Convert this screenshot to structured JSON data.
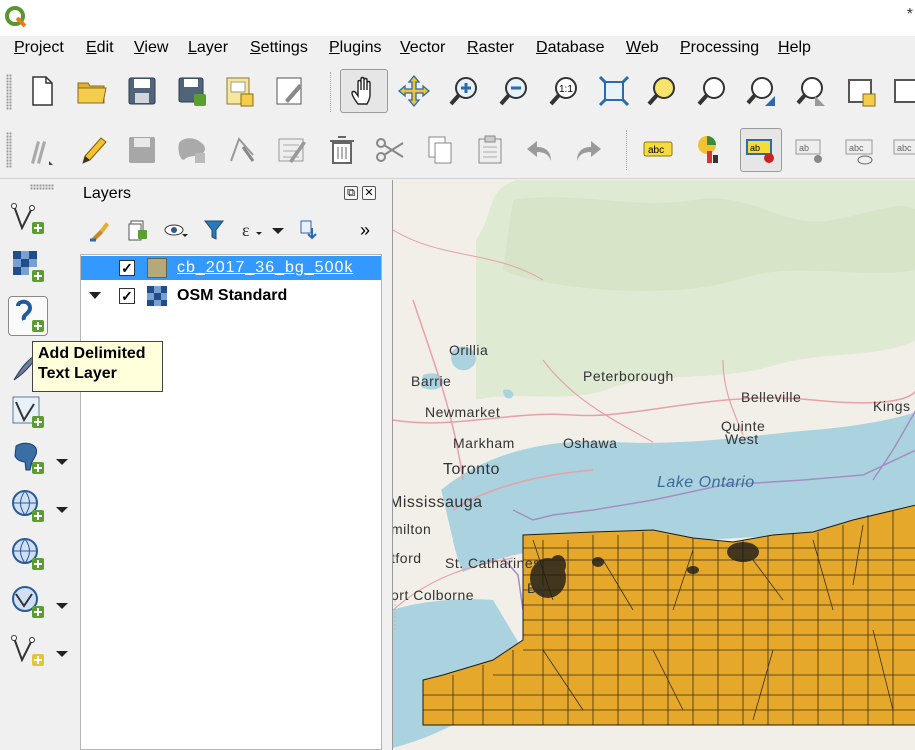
{
  "window": {
    "title_mark": "*"
  },
  "menu": [
    "Project",
    "Edit",
    "View",
    "Layer",
    "Settings",
    "Plugins",
    "Vector",
    "Raster",
    "Database",
    "Web",
    "Processing",
    "Help"
  ],
  "toolbar1_icons": [
    "new-project-icon",
    "open-project-icon",
    "save-project-icon",
    "save-as-icon",
    "new-print-layout-icon",
    "layout-manager-icon",
    "pan-icon",
    "pan-to-selection-icon",
    "zoom-in-icon",
    "zoom-out-icon",
    "zoom-native-icon",
    "zoom-full-icon",
    "zoom-to-selection-icon",
    "zoom-to-layer-icon",
    "zoom-last-icon",
    "zoom-next-icon",
    "new-map-view-icon",
    "new-3d-map-view-icon"
  ],
  "toolbar2_icons": [
    "digitize-icon",
    "toggle-editing-icon",
    "save-edits-icon",
    "add-feature-icon",
    "vertex-tool-icon",
    "modify-attributes-icon",
    "delete-selected-icon",
    "cut-features-icon",
    "copy-features-icon",
    "paste-features-icon",
    "undo-icon",
    "redo-icon",
    "layer-labeling-icon",
    "layer-diagram-icon",
    "highlight-pinned-labels-icon",
    "pin-labels-icon",
    "show-hide-labels-icon",
    "move-label-icon"
  ],
  "label_tool_text": "abc",
  "layers_panel": {
    "title": "Layers",
    "more": "»",
    "float_glyph": "⧉",
    "close_glyph": "✕",
    "layers": [
      {
        "name": "cb_2017_36_bg_500k",
        "checked": true,
        "check_glyph": "✓",
        "selected": true,
        "swatch": "#b5a879"
      },
      {
        "name": "OSM Standard",
        "checked": true,
        "check_glyph": "✓",
        "selected": false
      }
    ]
  },
  "tooltip": {
    "line1": "Add Delimited",
    "line2": "Text Layer"
  },
  "map": {
    "places": [
      "Orillia",
      "Barrie",
      "Peterborough",
      "Belleville",
      "Kings",
      "Newmarket",
      "Quinte",
      "West",
      "Markham",
      "Oshawa",
      "Toronto",
      "Lake Ontario",
      "Mississauga",
      "milton",
      "tford",
      "St. Catharines",
      "ort Colborne",
      "Bu"
    ],
    "colors": {
      "water": "#aad3df",
      "land": "#f2efe9",
      "forest": "#d6e6c6",
      "polygons": "#e5a82a"
    }
  },
  "colors": {
    "selection": "#3399ff",
    "tooltip_bg": "#ffffdc"
  }
}
